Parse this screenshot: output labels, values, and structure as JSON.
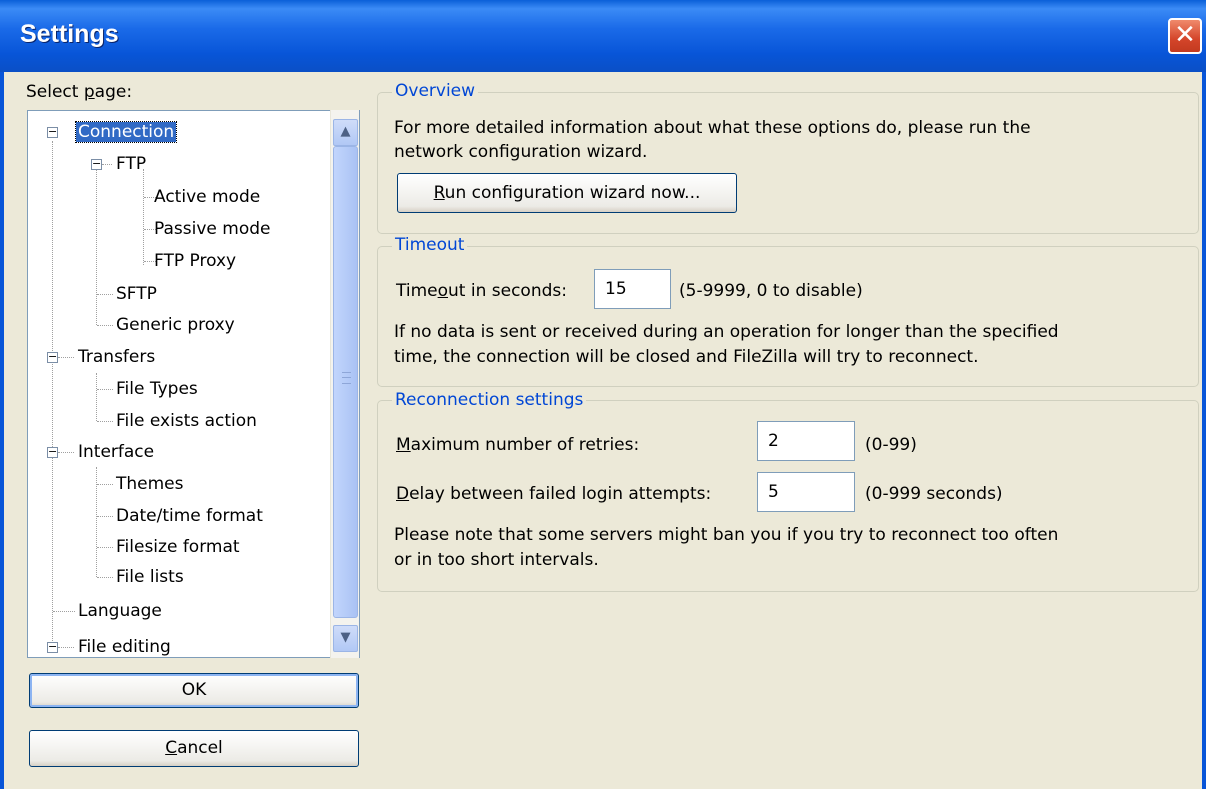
{
  "window": {
    "title": "Settings",
    "close_glyph": "✕"
  },
  "tree": {
    "label": "Select page:",
    "items": [
      {
        "label": "Connection",
        "selected": true,
        "expander": "minus"
      },
      {
        "label": "FTP",
        "expander": "minus"
      },
      {
        "label": "Active mode"
      },
      {
        "label": "Passive mode"
      },
      {
        "label": "FTP Proxy"
      },
      {
        "label": "SFTP"
      },
      {
        "label": "Generic proxy"
      },
      {
        "label": "Transfers",
        "expander": "minus"
      },
      {
        "label": "File Types"
      },
      {
        "label": "File exists action"
      },
      {
        "label": "Interface",
        "expander": "minus"
      },
      {
        "label": "Themes"
      },
      {
        "label": "Date/time format"
      },
      {
        "label": "Filesize format"
      },
      {
        "label": "File lists"
      },
      {
        "label": "Language"
      },
      {
        "label": "File editing",
        "expander": "minus"
      }
    ]
  },
  "buttons": {
    "ok": "OK",
    "cancel": "Cancel"
  },
  "overview": {
    "title": "Overview",
    "line1": "For more detailed information about what these options do, please run the",
    "line2": "network configuration wizard.",
    "wizard_button": "Run configuration wizard now..."
  },
  "timeout": {
    "title": "Timeout",
    "label": "Timeout in seconds:",
    "value": "15",
    "hint": "(5-9999, 0 to disable)",
    "line1": "If no data is sent or received during an operation for longer than the specified",
    "line2": "time, the connection will be closed and FileZilla will try to reconnect."
  },
  "reconnection": {
    "title": "Reconnection settings",
    "retries_label": "Maximum number of retries:",
    "retries_value": "2",
    "retries_hint": "(0-99)",
    "delay_label": "Delay between failed login attempts:",
    "delay_value": "5",
    "delay_hint": "(0-999 seconds)",
    "line1": "Please note that some servers might ban you if you try to reconnect too often",
    "line2": "or in too short intervals."
  },
  "colors": {
    "titlebar": "#0855d8",
    "selection": "#316ac5",
    "group_title": "#0046d5",
    "dialog_bg": "#ece9d8"
  }
}
